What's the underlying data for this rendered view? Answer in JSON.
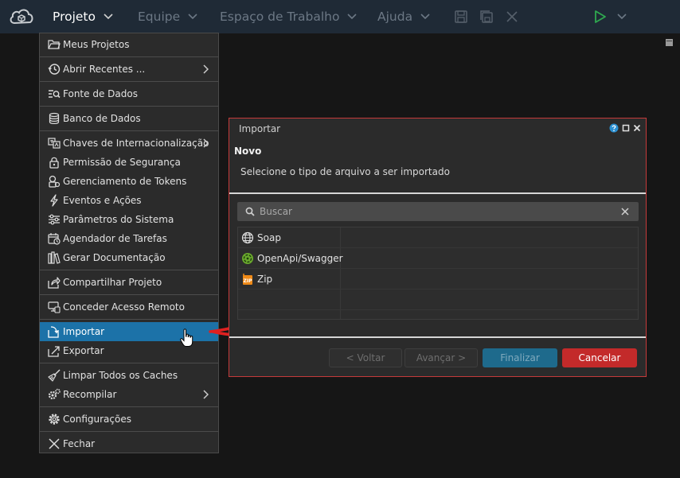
{
  "menubar": {
    "items": [
      {
        "label": "Projeto"
      },
      {
        "label": "Equipe"
      },
      {
        "label": "Espaço de Trabalho"
      },
      {
        "label": "Ajuda"
      }
    ]
  },
  "dropdown": {
    "items": [
      {
        "label": "Meus Projetos",
        "icon": "folder-open-icon"
      },
      {
        "label": "Abrir Recentes ...",
        "icon": "history-icon"
      },
      {
        "label": "Fonte de Dados",
        "icon": "datasource-search-icon"
      },
      {
        "label": "Banco de Dados",
        "icon": "database-icon"
      },
      {
        "label": "Chaves de Internacionalização",
        "icon": "translate-icon"
      },
      {
        "label": "Permissão de Segurança",
        "icon": "lock-icon"
      },
      {
        "label": "Gerenciamento de Tokens",
        "icon": "token-lock-icon"
      },
      {
        "label": "Eventos e Ações",
        "icon": "lightning-icon"
      },
      {
        "label": "Parâmetros do Sistema",
        "icon": "sliders-icon"
      },
      {
        "label": "Agendador de Tarefas",
        "icon": "calendar-clock-icon"
      },
      {
        "label": "Gerar Documentação",
        "icon": "books-icon"
      },
      {
        "label": "Compartilhar Projeto",
        "icon": "share-icon"
      },
      {
        "label": "Conceder Acesso Remoto",
        "icon": "remote-access-icon"
      },
      {
        "label": "Importar",
        "icon": "import-icon"
      },
      {
        "label": "Exportar",
        "icon": "export-icon"
      },
      {
        "label": "Limpar Todos os Caches",
        "icon": "broom-icon"
      },
      {
        "label": "Recompilar",
        "icon": "gears-icon"
      },
      {
        "label": "Configurações",
        "icon": "gear-icon"
      },
      {
        "label": "Fechar",
        "icon": "close-icon"
      }
    ]
  },
  "dialog": {
    "title": "Importar",
    "heading": "Novo",
    "subtitle": "Selecione o tipo de arquivo a ser importado",
    "search_placeholder": "Buscar",
    "items": [
      {
        "label": "Soap",
        "icon": "globe-icon"
      },
      {
        "label": "OpenApi/Swagger",
        "icon": "swagger-icon"
      },
      {
        "label": "Zip",
        "icon": "zip-icon"
      }
    ],
    "buttons": {
      "back": "< Voltar",
      "next": "Avançar >",
      "finish": "Finalizar",
      "cancel": "Cancelar"
    }
  },
  "colors": {
    "topbar": "#1f2a36",
    "selected": "#1c72a8",
    "dialog_border": "#c53a3a",
    "cancel": "#c32a2a",
    "finish": "#1e6a8c",
    "run": "#2fa84f"
  }
}
